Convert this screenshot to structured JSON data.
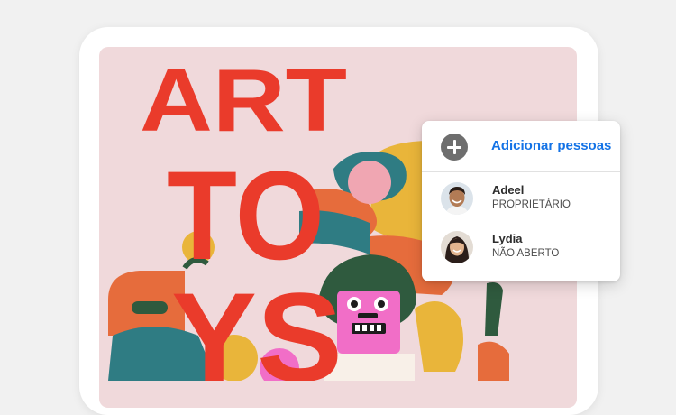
{
  "artwork": {
    "title_lines": [
      "ART",
      "TO",
      "YS"
    ]
  },
  "share_panel": {
    "add_label": "Adicionar pessoas",
    "add_icon": "plus-circle-icon",
    "people": [
      {
        "name": "Adeel",
        "role": "PROPRIETÁRIO"
      },
      {
        "name": "Lydia",
        "role": "NÃO ABERTO"
      }
    ]
  },
  "colors": {
    "accent": "#1473e6",
    "poster_background": "#f0d9db",
    "poster_red": "#ea3b2b",
    "page_background": "#f1f1f1"
  }
}
